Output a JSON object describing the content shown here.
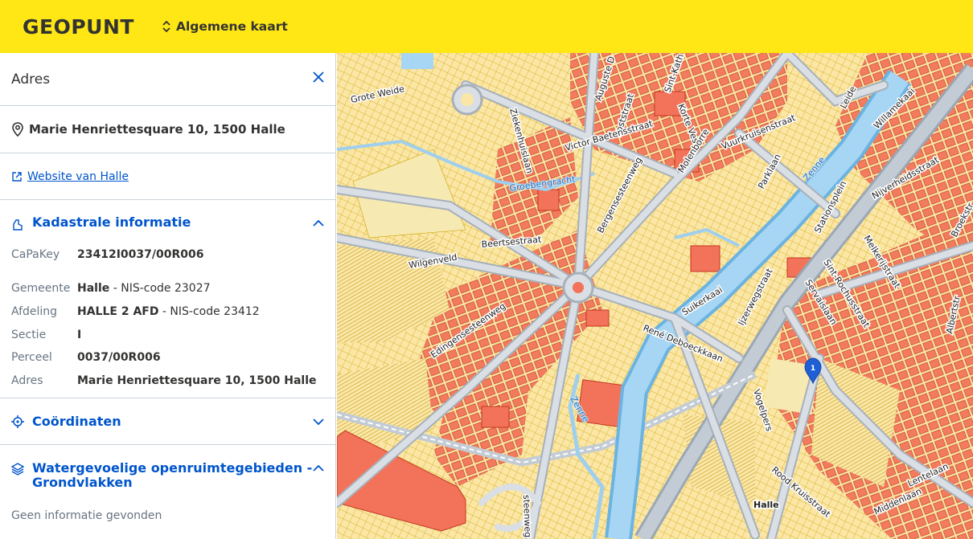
{
  "app": {
    "logo": "GEOPUNT",
    "layer_switch_label": "Algemene kaart"
  },
  "panel": {
    "title": "Adres",
    "address": "Marie Henriettesquare 10, 1500 Halle",
    "website_link": "Website van Halle",
    "cadastral": {
      "title": "Kadastrale informatie",
      "capakey_label": "CaPaKey",
      "capakey_value": "23412I0037/00R006",
      "gemeente_label": "Gemeente",
      "gemeente_name": "Halle",
      "gemeente_nis": " - NIS-code 23027",
      "afdeling_label": "Afdeling",
      "afdeling_name": "HALLE 2 AFD",
      "afdeling_nis": " - NIS-code 23412",
      "sectie_label": "Sectie",
      "sectie_value": "I",
      "perceel_label": "Perceel",
      "perceel_value": "0037/00R006",
      "adres_label": "Adres",
      "adres_value": "Marie Henriettesquare 10, 1500 Halle"
    },
    "coordinates": {
      "title": "Coördinaten"
    },
    "water": {
      "title_line1": "Watergevoelige openruimtegebieden -",
      "title_line2": "Grondvlakken",
      "empty_text": "Geen informatie gevonden"
    }
  },
  "map": {
    "marker_label": "1",
    "streets": {
      "grote_weide": "Grote Weide",
      "augustijnen": "Auguste D",
      "sint_kath": "Sint-Kath",
      "poststraat": "Poststraat",
      "korte_vest": "Korte Vest",
      "vuurkruisenstraat": "Vuurkruisenstraat",
      "leide": "Leide",
      "willamekaai": "Willamekaai",
      "ziekenhuislaan": "Ziekenhuislaan",
      "victor": "Victor Baetensstraat",
      "groebengracht": "Groebengracht",
      "bergensesteenweg": "Bergensesteenweg",
      "molenborre": "Molenborre",
      "parklaan": "Parklaan",
      "zenne1": "Zenne",
      "stationsplein": "Stationsplein",
      "nijverheidsstraat": "Nijverheidsstraat",
      "broekstr": "Broekstr",
      "beertsestraat": "Beertsestraat",
      "wilgenveld": "Wilgenveld",
      "melkerijstraat": "Melkerijstraat",
      "sint_rochus": "Sint-Rochusstraat",
      "servaislaan": "Servaislaan",
      "albertstr": "Albertstr",
      "ijzerwegstraat": "Ijzerwegstraat",
      "suikerkaai": "Suikerkaai",
      "edingensesteenweg": "Edingensesteenweg",
      "rene": "René Deboeckkaan",
      "vogelpers": "Vogelpers",
      "zenne2": "Zenne",
      "rood_kruis": "Rood Kruisstraat",
      "middenlaan": "Middenlaan",
      "lentelaan": "Lentelaan",
      "halle": "Halle",
      "steenweg": "steenweg"
    }
  }
}
